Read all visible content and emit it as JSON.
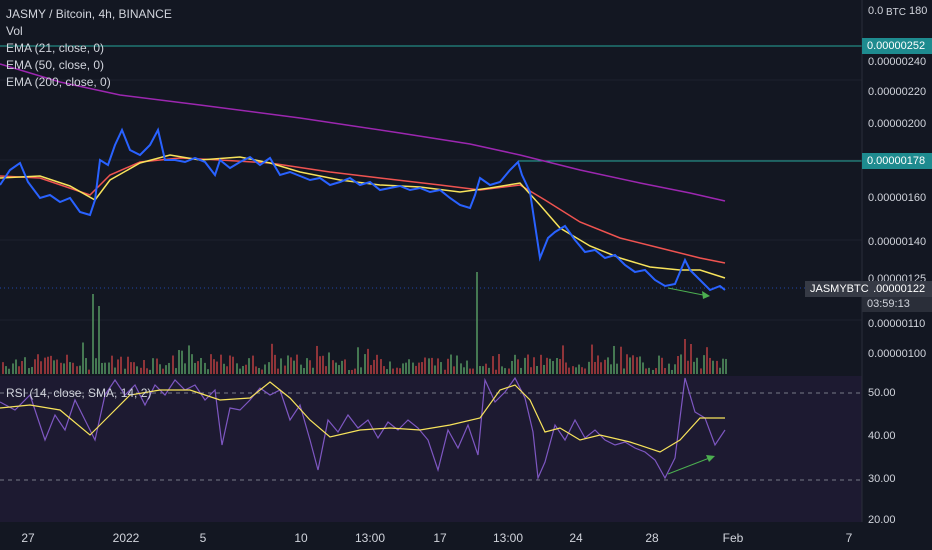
{
  "header": {
    "symbol_line": "JASMY / Bitcoin, 4h, BINANCE",
    "volume_label": "Vol",
    "ema_21_label": "EMA (21, close, 0)",
    "ema_50_label": "EMA (50, close, 0)",
    "ema_200_label": "EMA (200, close, 0)"
  },
  "rsi": {
    "label": "RSI (14, close, SMA, 14, 2)"
  },
  "price_scale": {
    "unit": "BTC",
    "top_label": "0.0",
    "top_label_right": "180",
    "labels": [
      "0.00000240",
      "0.00000220",
      "0.00000200",
      "0.00000160",
      "0.00000140",
      "0.00000125",
      "0.00000110",
      "0.00000100"
    ],
    "rsi_labels": [
      "50.00",
      "40.00",
      "30.00",
      "20.00"
    ],
    "tag_upper": "0.00000252",
    "tag_mid": "0.00000178",
    "tag_current": "0.00000122",
    "countdown": "03:59:13"
  },
  "symbol_tag": "JASMYBTC",
  "time_axis": [
    "27",
    "2022",
    "5",
    "10",
    "13:00",
    "17",
    "13:00",
    "24",
    "28",
    "Feb",
    "7"
  ],
  "colors": {
    "background": "#131722",
    "price_line": "#2962ff",
    "ema21": "#f7e35b",
    "ema50": "#ef5350",
    "ema200": "#9c27b0",
    "rsi_line": "#7e57c2",
    "rsi_sma": "#f7e35b",
    "level_line": "#26a69a",
    "volume_up": "#4f8a5a",
    "volume_down": "#a63a3d",
    "annotation_arrow": "#4caf50"
  }
}
